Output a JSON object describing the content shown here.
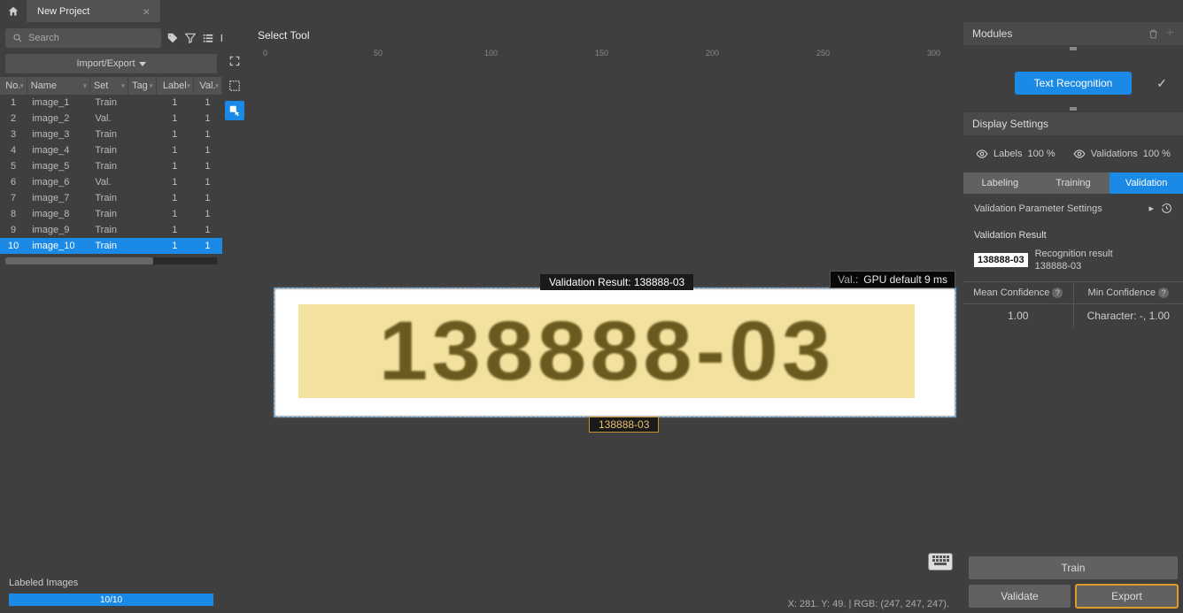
{
  "tab": {
    "title": "New Project"
  },
  "left": {
    "search_placeholder": "Search",
    "import_export": "Import/Export",
    "columns": {
      "no": "No.",
      "name": "Name",
      "set": "Set",
      "tag": "Tag",
      "label": "Label",
      "val": "Val."
    },
    "rows": [
      {
        "no": "1",
        "name": "image_1",
        "set": "Train",
        "tag": "",
        "label": "1",
        "val": "1",
        "selected": false
      },
      {
        "no": "2",
        "name": "image_2",
        "set": "Val.",
        "tag": "",
        "label": "1",
        "val": "1",
        "selected": false
      },
      {
        "no": "3",
        "name": "image_3",
        "set": "Train",
        "tag": "",
        "label": "1",
        "val": "1",
        "selected": false
      },
      {
        "no": "4",
        "name": "image_4",
        "set": "Train",
        "tag": "",
        "label": "1",
        "val": "1",
        "selected": false
      },
      {
        "no": "5",
        "name": "image_5",
        "set": "Train",
        "tag": "",
        "label": "1",
        "val": "1",
        "selected": false
      },
      {
        "no": "6",
        "name": "image_6",
        "set": "Val.",
        "tag": "",
        "label": "1",
        "val": "1",
        "selected": false
      },
      {
        "no": "7",
        "name": "image_7",
        "set": "Train",
        "tag": "",
        "label": "1",
        "val": "1",
        "selected": false
      },
      {
        "no": "8",
        "name": "image_8",
        "set": "Train",
        "tag": "",
        "label": "1",
        "val": "1",
        "selected": false
      },
      {
        "no": "9",
        "name": "image_9",
        "set": "Train",
        "tag": "",
        "label": "1",
        "val": "1",
        "selected": false
      },
      {
        "no": "10",
        "name": "image_10",
        "set": "Train",
        "tag": "",
        "label": "1",
        "val": "1",
        "selected": true
      }
    ],
    "labeled_title": "Labeled Images",
    "labeled_progress": "10/10"
  },
  "center": {
    "title": "Select Tool",
    "ruler_ticks": [
      "0",
      "50",
      "100",
      "150",
      "200",
      "250",
      "300"
    ],
    "validation_result_label": "Validation Result: 138888-03",
    "label_text": "138888-03",
    "big_text": "138888-03",
    "gpu_label": "Val.:",
    "gpu_value": "GPU default 9 ms",
    "status": "X: 281. Y: 49. | RGB: (247, 247, 247)."
  },
  "right": {
    "modules_title": "Modules",
    "module_button": "Text Recognition",
    "display_settings": "Display Settings",
    "labels": "Labels",
    "labels_pct": "100 %",
    "validations": "Validations",
    "validations_pct": "100 %",
    "tabs": {
      "labeling": "Labeling",
      "training": "Training",
      "validation": "Validation"
    },
    "param_settings": "Validation Parameter Settings",
    "validation_result": "Validation Result",
    "recog_thumb": "138888-03",
    "recog_title": "Recognition result",
    "recog_value": "138888-03",
    "mean_conf": "Mean Confidence",
    "min_conf": "Min Confidence",
    "mean_conf_val": "1.00",
    "min_conf_val": "Character: -, 1.00",
    "train_btn": "Train",
    "validate_btn": "Validate",
    "export_btn": "Export"
  }
}
